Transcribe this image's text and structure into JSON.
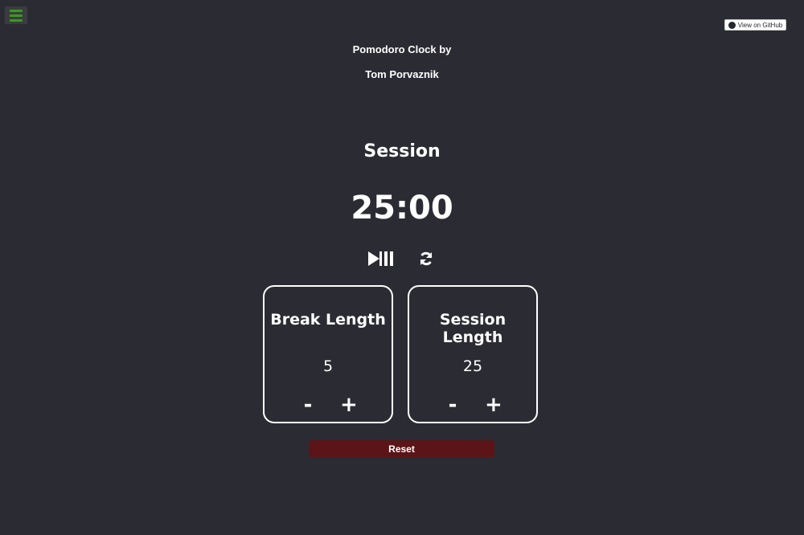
{
  "menu": {
    "icon": "hamburger-menu-icon"
  },
  "github": {
    "label": "View on GitHub",
    "icon": "github-icon"
  },
  "credits": {
    "line1": "Pomodoro Clock by",
    "line2": "Tom Porvaznik"
  },
  "timer": {
    "mode": "Session",
    "time": "25:00"
  },
  "controls": {
    "play_pause_icon": "play-pause-icon",
    "refresh_icon": "refresh-icon"
  },
  "break": {
    "title": "Break Length",
    "value": "5",
    "decrement": "-",
    "increment": "+"
  },
  "session": {
    "title": "Session Length",
    "value": "25",
    "decrement": "-",
    "increment": "+"
  },
  "reset": {
    "label": "Reset"
  },
  "colors": {
    "background": "#2b2c33",
    "reset": "#5b1518",
    "menu_accent": "#3a9a1e"
  }
}
